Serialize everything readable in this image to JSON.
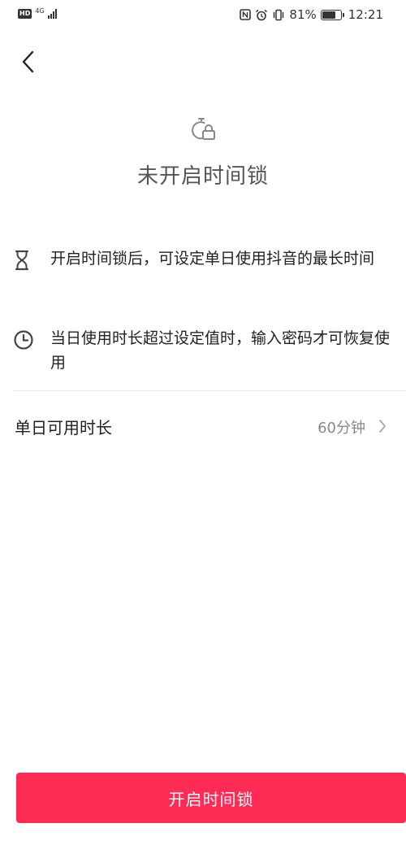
{
  "status_bar": {
    "hd_badge": "HD",
    "network": "4G",
    "battery_percent": "81%",
    "battery_level": 0.81,
    "time": "12:21"
  },
  "header": {
    "back_icon": "chevron-left-icon"
  },
  "lock_status": {
    "icon": "timer-lock-icon",
    "title": "未开启时间锁"
  },
  "info_items": [
    {
      "icon": "hourglass-icon",
      "text": "开启时间锁后，可设定单日使用抖音的最长时间"
    },
    {
      "icon": "clock-icon",
      "text": "当日使用时长超过设定值时，输入密码才可恢复使用"
    }
  ],
  "setting": {
    "label": "单日可用时长",
    "value": "60分钟",
    "chevron_icon": "chevron-right-icon"
  },
  "primary_button": {
    "label": "开启时间锁"
  },
  "colors": {
    "accent": "#fe2c55",
    "text_primary": "#222222",
    "text_secondary": "#888888",
    "title": "#555555"
  }
}
